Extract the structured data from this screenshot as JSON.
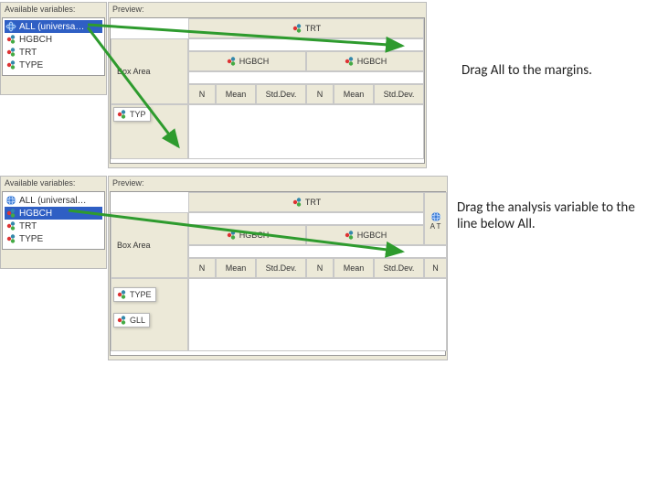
{
  "captions": {
    "step1": "Drag All to the margins.",
    "step2": "Drag the analysis variable to the line below All."
  },
  "panel1": {
    "available_label": "Available variables:",
    "preview_label": "Preview:",
    "box_area": "Box Area",
    "vars": {
      "all": {
        "label": "ALL (universa…",
        "icon": "globe"
      },
      "hgbch": {
        "label": "HGBCH",
        "icon": "class"
      },
      "trt": {
        "label": "TRT",
        "icon": "class"
      },
      "type": {
        "label": "TYPE",
        "icon": "class"
      }
    },
    "selected": "all",
    "drag_type": {
      "label": "TYP",
      "icon": "class"
    },
    "top_header": {
      "label": "TRT",
      "icon": "class"
    },
    "row_header1": {
      "label": "HGBCH",
      "icon": "class"
    },
    "row_header2": {
      "label": "HGBCH",
      "icon": "class"
    },
    "stats": [
      "N",
      "Mean",
      "Std.Dev.",
      "N",
      "Mean",
      "Std.Dev."
    ]
  },
  "panel2": {
    "available_label": "Available variables:",
    "preview_label": "Preview:",
    "box_area": "Box Area",
    "vars": {
      "all": {
        "label": "ALL (universal…",
        "icon": "globe"
      },
      "hgbch": {
        "label": "HGBCH",
        "icon": "class"
      },
      "trt": {
        "label": "TRT",
        "icon": "class"
      },
      "type": {
        "label": "TYPE",
        "icon": "class"
      }
    },
    "selected": "hgbch",
    "drag_type": {
      "label": "TYPE",
      "icon": "class"
    },
    "drag_gll": {
      "label": "GLL",
      "icon": "class"
    },
    "top_header": {
      "label": "TRT",
      "icon": "class"
    },
    "all_right": {
      "label": "A T",
      "icon": "globe"
    },
    "row_header1": {
      "label": "HGBCH",
      "icon": "class"
    },
    "row_header2": {
      "label": "HGBCH",
      "icon": "class"
    },
    "stats": [
      "N",
      "Mean",
      "Std.Dev.",
      "N",
      "Mean",
      "Std.Dev.",
      "N"
    ]
  }
}
